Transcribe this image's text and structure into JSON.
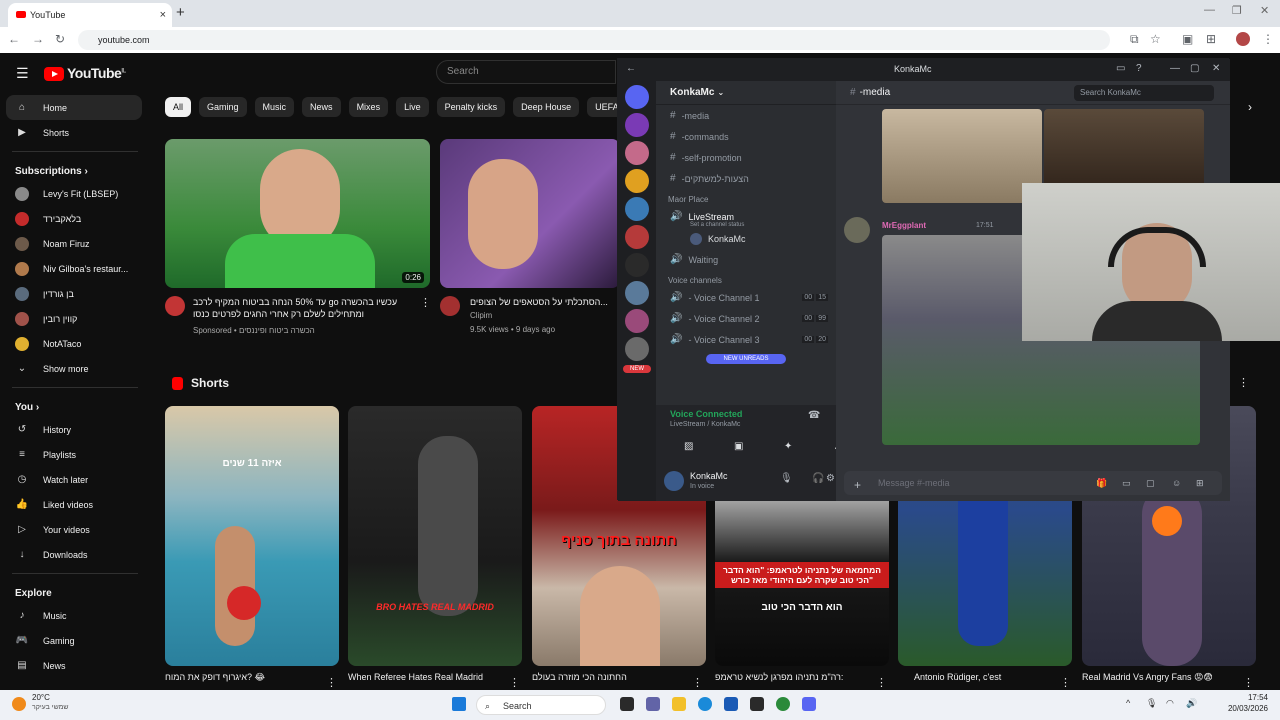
{
  "browser": {
    "tab_title": "YouTube",
    "new_tab": "+",
    "close_tab": "×",
    "url": "youtube.com"
  },
  "youtube": {
    "logo": "YouTube",
    "logo_region": "IL",
    "search_placeholder": "Search",
    "sidebar": {
      "main": [
        {
          "label": "Home",
          "icon": "home-icon"
        },
        {
          "label": "Shorts",
          "icon": "shorts-icon"
        }
      ],
      "subscriptions_header": "Subscriptions",
      "subscriptions": [
        {
          "label": "Levy's Fit (LBSEP)",
          "color": "#8a8a8a"
        },
        {
          "label": "בלאקבירד",
          "color": "#c42b2b"
        },
        {
          "label": "Noam Firuz",
          "color": "#6d5a4a"
        },
        {
          "label": "Niv Gilboa's restaur...",
          "color": "#b07a4c"
        },
        {
          "label": "בן גורדין",
          "color": "#5a6b7d"
        },
        {
          "label": "קווין רובין",
          "color": "#a0524a"
        },
        {
          "label": "NotATaco",
          "color": "#e0b030"
        }
      ],
      "show_more": "Show more",
      "you_header": "You",
      "you": [
        {
          "label": "History",
          "icon": "history-icon"
        },
        {
          "label": "Playlists",
          "icon": "playlists-icon"
        },
        {
          "label": "Watch later",
          "icon": "watch-later-icon"
        },
        {
          "label": "Liked videos",
          "icon": "liked-icon"
        },
        {
          "label": "Your videos",
          "icon": "your-videos-icon"
        },
        {
          "label": "Downloads",
          "icon": "downloads-icon"
        }
      ],
      "explore_header": "Explore",
      "explore": [
        {
          "label": "Music",
          "icon": "music-icon"
        },
        {
          "label": "Gaming",
          "icon": "gaming-icon"
        },
        {
          "label": "News",
          "icon": "news-icon"
        }
      ]
    },
    "chips": [
      "All",
      "Gaming",
      "Music",
      "News",
      "Mixes",
      "Live",
      "Penalty kicks",
      "Deep House",
      "UEFA Cha"
    ],
    "videos": [
      {
        "title": "עד 50% הנחה בביטוח המקיף לרכב go עכשיו בהכשרה ומתחילים לשלם רק אחרי החגים לפרטים כנסו",
        "meta": "Sponsored • הכשרה ביטוח ופיננסים",
        "duration": "0:26"
      },
      {
        "title": "הסתכלתי על הסטאפים של הצופים...",
        "channel": "Clipim",
        "meta": "9.5K views • 9 days ago"
      }
    ],
    "shorts_header": "Shorts",
    "shorts": [
      {
        "title": "איגרוף דופק את המוח? 😂",
        "overlay": "איזה 11 שנים"
      },
      {
        "title": "When Referee Hates Real Madrid",
        "overlay": "BRO HATES REAL MADRID"
      },
      {
        "title": "החתונה הכי מוזרה בעולם",
        "overlay": "חתונה בתוך סניף"
      },
      {
        "title": "רה\"מ נתניהו מפרגן לנשיא טראמפ:",
        "overlay": "המחמאה של נתניהו לטראמפ: \"הוא הדבר הכי טוב שקרה לעם היהודי מאז כורש\"",
        "overlay2": "הוא הדבר הכי טוב"
      },
      {
        "title": "Antonio Rüdiger, c'est",
        "overlay": ""
      },
      {
        "title": "Real Madrid Vs Angry Fans 😡😨",
        "overlay": ""
      }
    ]
  },
  "discord": {
    "window_title": "KonkaMc",
    "server_name": "KonkaMc",
    "channels_top": [
      "-media",
      "-commands",
      "-self-promotion",
      "-הצעות-למשתקים"
    ],
    "category_place": "Maor Place",
    "livestream": "LiveStream",
    "livestream_status": "Set a channel status",
    "live_user": "KonkaMc",
    "waiting": "Waiting",
    "category_voice": "Voice channels",
    "voice_channels": [
      {
        "name": "- Voice Channel 1",
        "a": "00",
        "b": "15"
      },
      {
        "name": "- Voice Channel 2",
        "a": "00",
        "b": "99"
      },
      {
        "name": "- Voice Channel 3",
        "a": "00",
        "b": "20"
      }
    ],
    "new_unreads": "NEW UNREADS",
    "voice_connected": "Voice Connected",
    "voice_location": "LiveStream / KonkaMc",
    "user_name": "KonkaMc",
    "user_status": "In voice",
    "channel_header": "-media",
    "search_placeholder": "Search KonkaMc",
    "message_author": "MrEggplant",
    "message_time": "17:51",
    "message_placeholder": "Message #-media",
    "badge_new": "NEW"
  },
  "taskbar": {
    "weather_temp": "20°C",
    "weather_desc": "שמשי בעיקר",
    "search": "Search",
    "time": "17:54",
    "date": "20/03/2026"
  }
}
